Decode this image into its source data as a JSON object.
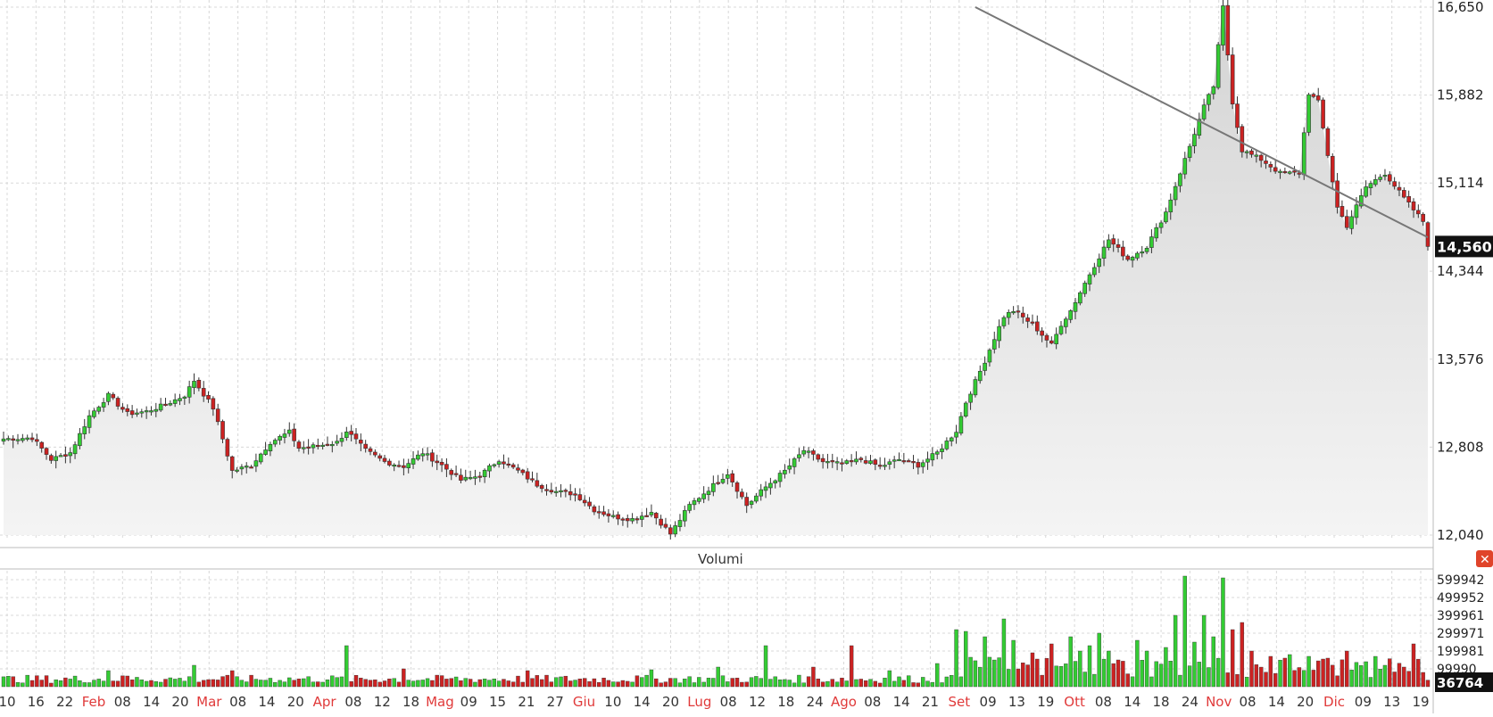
{
  "chart_data": {
    "type": "candlestick",
    "main_panel": {
      "y_ticks": [
        "16,650",
        "15,882",
        "15,114",
        "14,344",
        "13,576",
        "12,808",
        "12,040"
      ],
      "y_tick_values": [
        16650,
        15882,
        15114,
        14344,
        13576,
        12808,
        12040
      ],
      "ylim": [
        12040,
        16650
      ],
      "last_price_label": "14,560",
      "last_price": 14560,
      "grid": true,
      "area_fill": true,
      "trendline": {
        "from": {
          "index": 204,
          "value": 16650
        },
        "to": {
          "index": 299,
          "value": 14640
        }
      },
      "candles_count": 300,
      "anchors": [
        [
          0,
          12880
        ],
        [
          6,
          12890
        ],
        [
          10,
          12700
        ],
        [
          14,
          12760
        ],
        [
          18,
          13080
        ],
        [
          22,
          13260
        ],
        [
          26,
          13100
        ],
        [
          30,
          13120
        ],
        [
          34,
          13180
        ],
        [
          38,
          13260
        ],
        [
          40,
          13390
        ],
        [
          44,
          13150
        ],
        [
          46,
          12880
        ],
        [
          48,
          12600
        ],
        [
          52,
          12650
        ],
        [
          56,
          12850
        ],
        [
          60,
          12940
        ],
        [
          62,
          12800
        ],
        [
          66,
          12820
        ],
        [
          70,
          12850
        ],
        [
          72,
          12950
        ],
        [
          76,
          12780
        ],
        [
          80,
          12680
        ],
        [
          84,
          12640
        ],
        [
          88,
          12760
        ],
        [
          92,
          12650
        ],
        [
          96,
          12520
        ],
        [
          100,
          12560
        ],
        [
          104,
          12700
        ],
        [
          108,
          12600
        ],
        [
          112,
          12480
        ],
        [
          116,
          12420
        ],
        [
          120,
          12400
        ],
        [
          124,
          12260
        ],
        [
          128,
          12200
        ],
        [
          132,
          12180
        ],
        [
          136,
          12240
        ],
        [
          140,
          12050
        ],
        [
          144,
          12300
        ],
        [
          148,
          12440
        ],
        [
          152,
          12580
        ],
        [
          156,
          12300
        ],
        [
          160,
          12460
        ],
        [
          164,
          12600
        ],
        [
          168,
          12780
        ],
        [
          172,
          12680
        ],
        [
          176,
          12660
        ],
        [
          180,
          12700
        ],
        [
          184,
          12640
        ],
        [
          188,
          12700
        ],
        [
          192,
          12650
        ],
        [
          196,
          12760
        ],
        [
          200,
          12950
        ],
        [
          202,
          13200
        ],
        [
          206,
          13560
        ],
        [
          208,
          13760
        ],
        [
          210,
          13950
        ],
        [
          212,
          14000
        ],
        [
          216,
          13880
        ],
        [
          220,
          13700
        ],
        [
          222,
          13880
        ],
        [
          224,
          14000
        ],
        [
          228,
          14320
        ],
        [
          232,
          14620
        ],
        [
          236,
          14450
        ],
        [
          240,
          14560
        ],
        [
          244,
          14860
        ],
        [
          248,
          15320
        ],
        [
          252,
          15780
        ],
        [
          254,
          15960
        ],
        [
          256,
          16650
        ],
        [
          258,
          15820
        ],
        [
          260,
          15400
        ],
        [
          264,
          15320
        ],
        [
          268,
          15200
        ],
        [
          272,
          15200
        ],
        [
          274,
          15900
        ],
        [
          276,
          15820
        ],
        [
          278,
          15360
        ],
        [
          280,
          14900
        ],
        [
          282,
          14740
        ],
        [
          286,
          15080
        ],
        [
          290,
          15200
        ],
        [
          294,
          14980
        ],
        [
          298,
          14780
        ],
        [
          299,
          14560
        ]
      ]
    },
    "volume_panel": {
      "title": "Volumi",
      "y_ticks": [
        "599942",
        "499952",
        "399961",
        "299971",
        "199981",
        "99990"
      ],
      "y_tick_values": [
        599942,
        499952,
        399961,
        299971,
        199981,
        99990
      ],
      "ylim": [
        0,
        640000
      ],
      "last_volume_label": "36764",
      "last_volume": 36764,
      "spikes": [
        [
          22,
          90000
        ],
        [
          26,
          60000
        ],
        [
          40,
          120000
        ],
        [
          48,
          90000
        ],
        [
          72,
          230000
        ],
        [
          84,
          100000
        ],
        [
          110,
          90000
        ],
        [
          136,
          95000
        ],
        [
          150,
          110000
        ],
        [
          160,
          230000
        ],
        [
          170,
          110000
        ],
        [
          178,
          230000
        ],
        [
          186,
          90000
        ],
        [
          196,
          130000
        ],
        [
          200,
          320000
        ],
        [
          202,
          310000
        ],
        [
          206,
          280000
        ],
        [
          210,
          380000
        ],
        [
          212,
          260000
        ],
        [
          216,
          190000
        ],
        [
          220,
          240000
        ],
        [
          224,
          280000
        ],
        [
          226,
          200000
        ],
        [
          228,
          230000
        ],
        [
          230,
          300000
        ],
        [
          232,
          200000
        ],
        [
          234,
          150000
        ],
        [
          238,
          260000
        ],
        [
          240,
          200000
        ],
        [
          244,
          220000
        ],
        [
          246,
          400000
        ],
        [
          248,
          620000
        ],
        [
          250,
          250000
        ],
        [
          252,
          400000
        ],
        [
          254,
          280000
        ],
        [
          256,
          610000
        ],
        [
          258,
          320000
        ],
        [
          260,
          360000
        ],
        [
          262,
          200000
        ],
        [
          266,
          170000
        ],
        [
          270,
          180000
        ],
        [
          274,
          170000
        ],
        [
          278,
          160000
        ],
        [
          282,
          200000
        ],
        [
          286,
          140000
        ],
        [
          290,
          120000
        ],
        [
          294,
          110000
        ],
        [
          296,
          240000
        ],
        [
          298,
          80000
        ],
        [
          299,
          36764
        ]
      ]
    },
    "x_axis": {
      "tick_labels": [
        {
          "text": "10",
          "month": false
        },
        {
          "text": "16",
          "month": false
        },
        {
          "text": "22",
          "month": false
        },
        {
          "text": "Feb",
          "month": true
        },
        {
          "text": "08",
          "month": false
        },
        {
          "text": "14",
          "month": false
        },
        {
          "text": "20",
          "month": false
        },
        {
          "text": "Mar",
          "month": true
        },
        {
          "text": "08",
          "month": false
        },
        {
          "text": "14",
          "month": false
        },
        {
          "text": "20",
          "month": false
        },
        {
          "text": "Apr",
          "month": true
        },
        {
          "text": "08",
          "month": false
        },
        {
          "text": "12",
          "month": false
        },
        {
          "text": "18",
          "month": false
        },
        {
          "text": "Mag",
          "month": true
        },
        {
          "text": "09",
          "month": false
        },
        {
          "text": "15",
          "month": false
        },
        {
          "text": "21",
          "month": false
        },
        {
          "text": "27",
          "month": false
        },
        {
          "text": "Giu",
          "month": true
        },
        {
          "text": "10",
          "month": false
        },
        {
          "text": "14",
          "month": false
        },
        {
          "text": "20",
          "month": false
        },
        {
          "text": "Lug",
          "month": true
        },
        {
          "text": "08",
          "month": false
        },
        {
          "text": "12",
          "month": false
        },
        {
          "text": "18",
          "month": false
        },
        {
          "text": "24",
          "month": false
        },
        {
          "text": "Ago",
          "month": true
        },
        {
          "text": "08",
          "month": false
        },
        {
          "text": "14",
          "month": false
        },
        {
          "text": "21",
          "month": false
        },
        {
          "text": "Set",
          "month": true
        },
        {
          "text": "09",
          "month": false
        },
        {
          "text": "13",
          "month": false
        },
        {
          "text": "19",
          "month": false
        },
        {
          "text": "Ott",
          "month": true
        },
        {
          "text": "08",
          "month": false
        },
        {
          "text": "14",
          "month": false
        },
        {
          "text": "18",
          "month": false
        },
        {
          "text": "24",
          "month": false
        },
        {
          "text": "Nov",
          "month": true
        },
        {
          "text": "08",
          "month": false
        },
        {
          "text": "14",
          "month": false
        },
        {
          "text": "20",
          "month": false
        },
        {
          "text": "Dic",
          "month": true
        },
        {
          "text": "09",
          "month": false
        },
        {
          "text": "13",
          "month": false
        },
        {
          "text": "19",
          "month": false
        }
      ]
    }
  },
  "colors": {
    "up": "#33cc33",
    "down": "#cc2222",
    "grid": "#d8d8d8",
    "area_top": "#d4d4d4",
    "area_bottom": "#f4f4f4",
    "label_bg": "#111111",
    "close_bg": "#e0442a",
    "trendline": "#777777"
  },
  "icons": {
    "close": "close-icon"
  }
}
